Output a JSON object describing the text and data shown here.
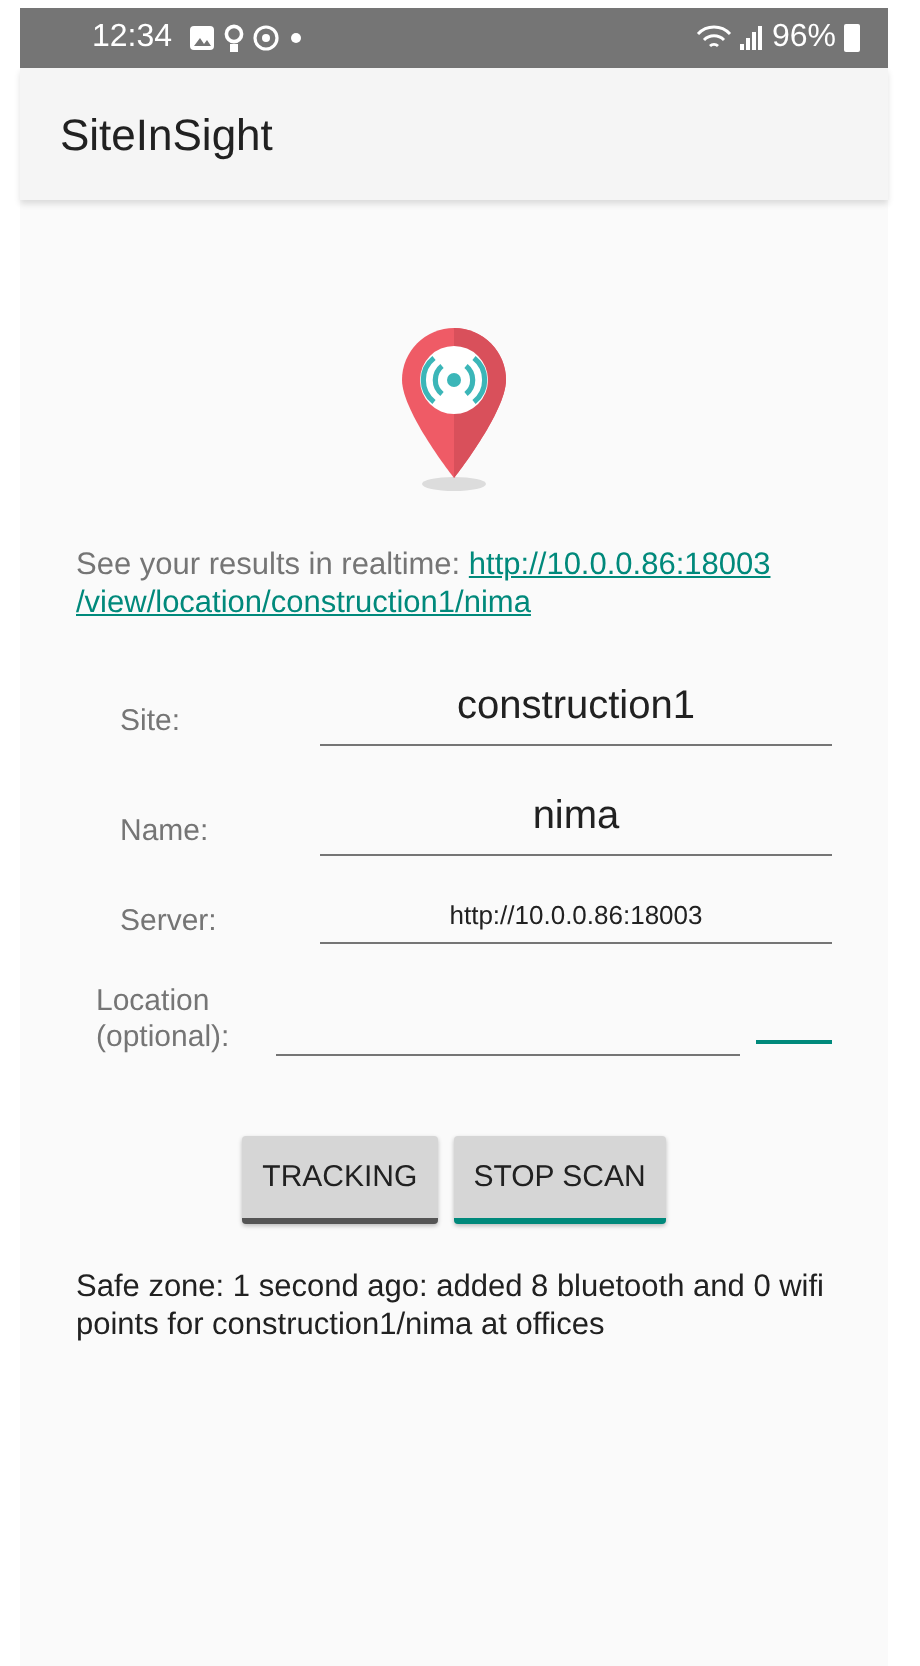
{
  "status_bar": {
    "time": "12:34",
    "battery": "96%"
  },
  "app_bar": {
    "title": "SiteInSight"
  },
  "realtime": {
    "text": "See your results in realtime: ",
    "link_lines": [
      "http://10.0.0.86:18003",
      "/view/location/construction1/nima"
    ]
  },
  "fields": [
    {
      "label": "Site:",
      "value": "construction1",
      "kind": "text"
    },
    {
      "label": "Name:",
      "value": "nima",
      "kind": "text"
    },
    {
      "label": "Server:",
      "value": "http://10.0.0.86:18003",
      "kind": "url"
    },
    {
      "label": "Location (optional):",
      "kind": "with-spinner"
    }
  ],
  "buttons": [
    {
      "label": "TRACKING",
      "color": "#555555"
    },
    {
      "label": "STOP SCAN",
      "color": "#00897b"
    }
  ],
  "message": "Safe zone: 1 second ago: added 8 bluetooth and 0 wifi points for construction1/nima at offices"
}
